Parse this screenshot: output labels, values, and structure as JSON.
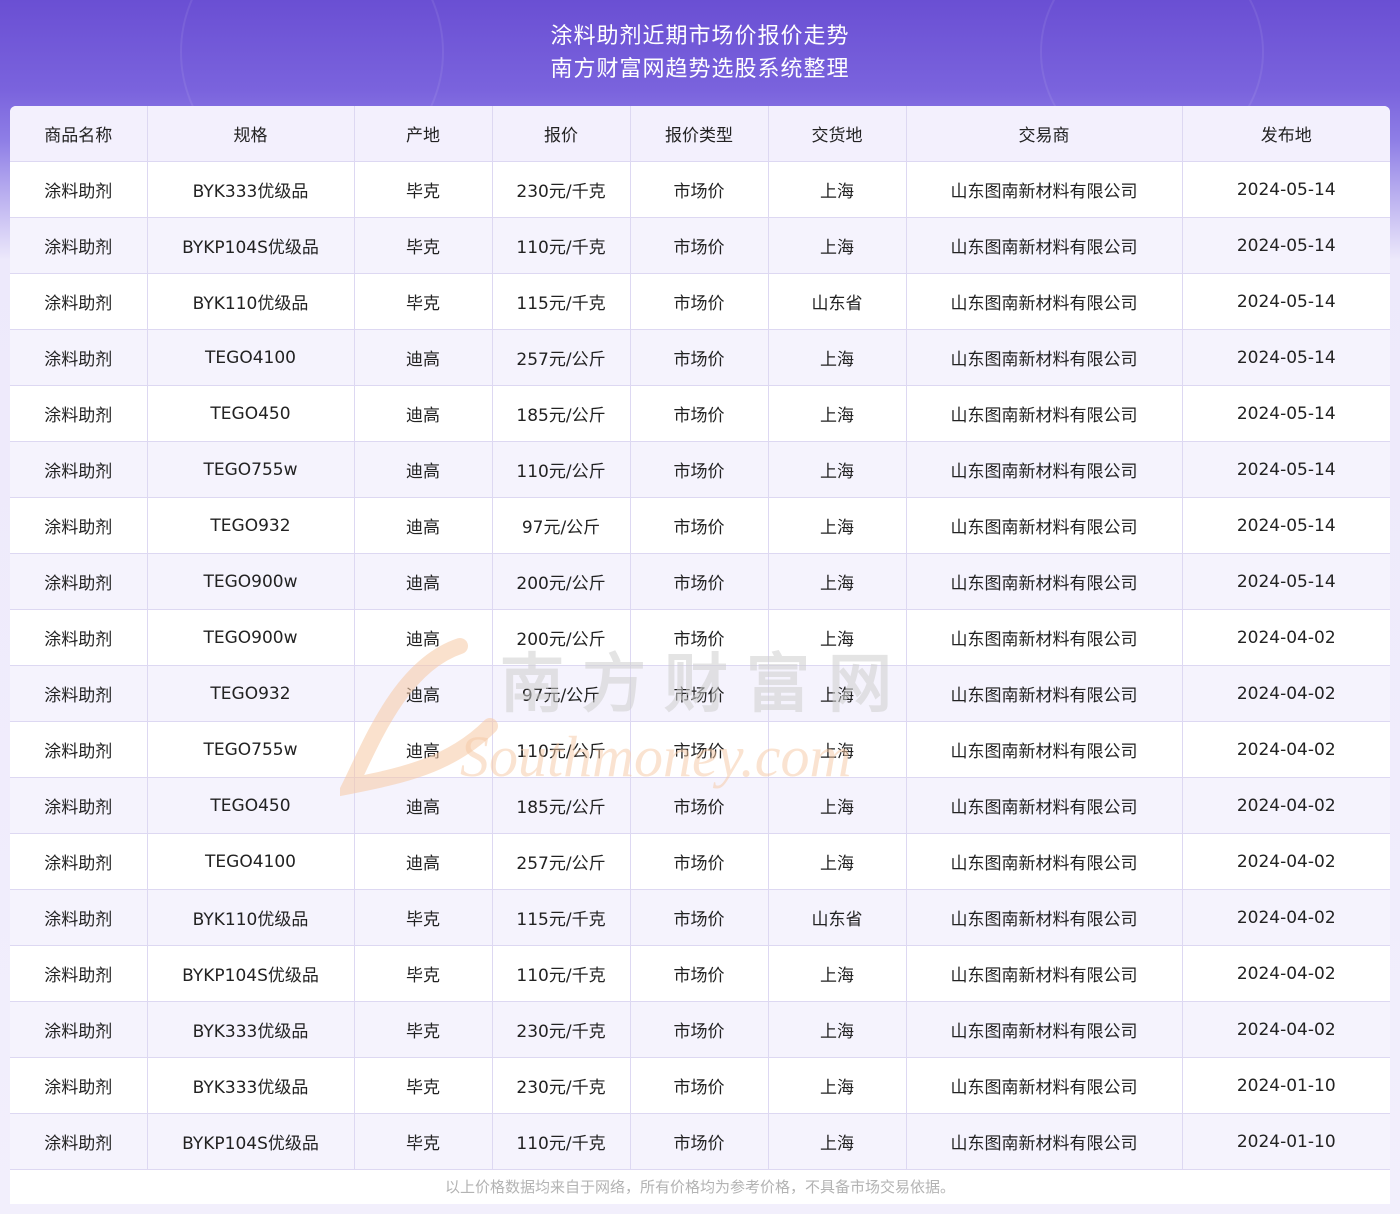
{
  "header": {
    "title_line1": "涂料助剂近期市场价报价走势",
    "title_line2": "南方财富网趋势选股系统整理"
  },
  "table": {
    "columns": [
      "商品名称",
      "规格",
      "产地",
      "报价",
      "报价类型",
      "交货地",
      "交易商",
      "发布地"
    ],
    "rows": [
      [
        "涂料助剂",
        "BYK333优级品",
        "毕克",
        "230元/千克",
        "市场价",
        "上海",
        "山东图南新材料有限公司",
        "2024-05-14"
      ],
      [
        "涂料助剂",
        "BYKP104S优级品",
        "毕克",
        "110元/千克",
        "市场价",
        "上海",
        "山东图南新材料有限公司",
        "2024-05-14"
      ],
      [
        "涂料助剂",
        "BYK110优级品",
        "毕克",
        "115元/千克",
        "市场价",
        "山东省",
        "山东图南新材料有限公司",
        "2024-05-14"
      ],
      [
        "涂料助剂",
        "TEGO4100",
        "迪高",
        "257元/公斤",
        "市场价",
        "上海",
        "山东图南新材料有限公司",
        "2024-05-14"
      ],
      [
        "涂料助剂",
        "TEGO450",
        "迪高",
        "185元/公斤",
        "市场价",
        "上海",
        "山东图南新材料有限公司",
        "2024-05-14"
      ],
      [
        "涂料助剂",
        "TEGO755w",
        "迪高",
        "110元/公斤",
        "市场价",
        "上海",
        "山东图南新材料有限公司",
        "2024-05-14"
      ],
      [
        "涂料助剂",
        "TEGO932",
        "迪高",
        "97元/公斤",
        "市场价",
        "上海",
        "山东图南新材料有限公司",
        "2024-05-14"
      ],
      [
        "涂料助剂",
        "TEGO900w",
        "迪高",
        "200元/公斤",
        "市场价",
        "上海",
        "山东图南新材料有限公司",
        "2024-05-14"
      ],
      [
        "涂料助剂",
        "TEGO900w",
        "迪高",
        "200元/公斤",
        "市场价",
        "上海",
        "山东图南新材料有限公司",
        "2024-04-02"
      ],
      [
        "涂料助剂",
        "TEGO932",
        "迪高",
        "97元/公斤",
        "市场价",
        "上海",
        "山东图南新材料有限公司",
        "2024-04-02"
      ],
      [
        "涂料助剂",
        "TEGO755w",
        "迪高",
        "110元/公斤",
        "市场价",
        "上海",
        "山东图南新材料有限公司",
        "2024-04-02"
      ],
      [
        "涂料助剂",
        "TEGO450",
        "迪高",
        "185元/公斤",
        "市场价",
        "上海",
        "山东图南新材料有限公司",
        "2024-04-02"
      ],
      [
        "涂料助剂",
        "TEGO4100",
        "迪高",
        "257元/公斤",
        "市场价",
        "上海",
        "山东图南新材料有限公司",
        "2024-04-02"
      ],
      [
        "涂料助剂",
        "BYK110优级品",
        "毕克",
        "115元/千克",
        "市场价",
        "山东省",
        "山东图南新材料有限公司",
        "2024-04-02"
      ],
      [
        "涂料助剂",
        "BYKP104S优级品",
        "毕克",
        "110元/千克",
        "市场价",
        "上海",
        "山东图南新材料有限公司",
        "2024-04-02"
      ],
      [
        "涂料助剂",
        "BYK333优级品",
        "毕克",
        "230元/千克",
        "市场价",
        "上海",
        "山东图南新材料有限公司",
        "2024-04-02"
      ],
      [
        "涂料助剂",
        "BYK333优级品",
        "毕克",
        "230元/千克",
        "市场价",
        "上海",
        "山东图南新材料有限公司",
        "2024-01-10"
      ],
      [
        "涂料助剂",
        "BYKP104S优级品",
        "毕克",
        "110元/千克",
        "市场价",
        "上海",
        "山东图南新材料有限公司",
        "2024-01-10"
      ]
    ]
  },
  "watermark": {
    "text_cn": "南方财富网",
    "text_en": "Southmoney.com"
  },
  "footer": {
    "note": "以上价格数据均来自于网络，所有价格均为参考价格，不具备市场交易依据。"
  },
  "colors": {
    "header_gradient_top": "#6a4fd3",
    "row_alt": "#f5f3fd",
    "grid_line": "#ddd8f2",
    "watermark_orange": "#f6c9a4"
  }
}
